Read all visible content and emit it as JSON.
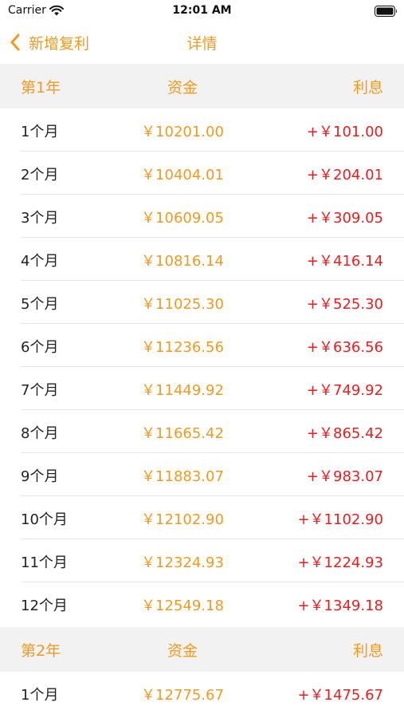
{
  "status_bar": {
    "carrier": "Carrier",
    "time": "12:01 AM"
  },
  "nav": {
    "back_label": "新增复利",
    "title": "详情",
    "accent_color": "#f29a1f"
  },
  "colors": {
    "capital": "#f29a1f",
    "interest": "#ee1c1c",
    "header_bg": "#f2f2f2"
  },
  "sections": [
    {
      "year_label": "第1年",
      "capital_header": "资金",
      "interest_header": "利息",
      "rows": [
        {
          "month": "1个月",
          "capital": "￥10201.00",
          "interest": "+￥101.00"
        },
        {
          "month": "2个月",
          "capital": "￥10404.01",
          "interest": "+￥204.01"
        },
        {
          "month": "3个月",
          "capital": "￥10609.05",
          "interest": "+￥309.05"
        },
        {
          "month": "4个月",
          "capital": "￥10816.14",
          "interest": "+￥416.14"
        },
        {
          "month": "5个月",
          "capital": "￥11025.30",
          "interest": "+￥525.30"
        },
        {
          "month": "6个月",
          "capital": "￥11236.56",
          "interest": "+￥636.56"
        },
        {
          "month": "7个月",
          "capital": "￥11449.92",
          "interest": "+￥749.92"
        },
        {
          "month": "8个月",
          "capital": "￥11665.42",
          "interest": "+￥865.42"
        },
        {
          "month": "9个月",
          "capital": "￥11883.07",
          "interest": "+￥983.07"
        },
        {
          "month": "10个月",
          "capital": "￥12102.90",
          "interest": "+￥1102.90"
        },
        {
          "month": "11个月",
          "capital": "￥12324.93",
          "interest": "+￥1224.93"
        },
        {
          "month": "12个月",
          "capital": "￥12549.18",
          "interest": "+￥1349.18"
        }
      ]
    },
    {
      "year_label": "第2年",
      "capital_header": "资金",
      "interest_header": "利息",
      "rows": [
        {
          "month": "1个月",
          "capital": "￥12775.67",
          "interest": "+￥1475.67"
        }
      ]
    }
  ]
}
